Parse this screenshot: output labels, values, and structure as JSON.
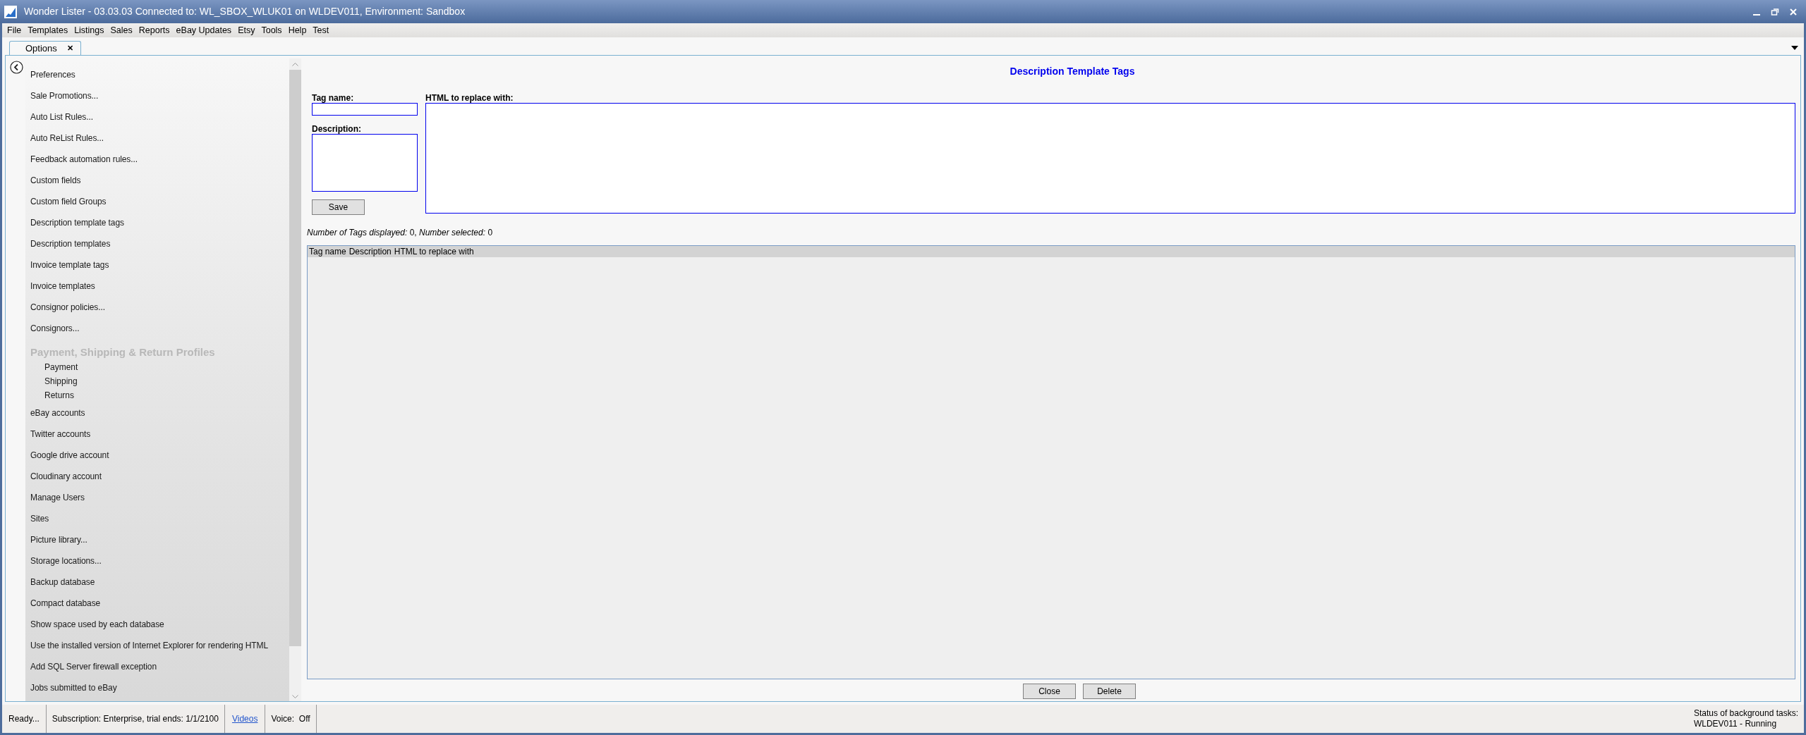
{
  "window": {
    "title": "Wonder Lister - 03.03.03 Connected to: WL_SBOX_WLUK01 on WLDEV011, Environment: Sandbox"
  },
  "menu": [
    "File",
    "Templates",
    "Listings",
    "Sales",
    "Reports",
    "eBay Updates",
    "Etsy",
    "Tools",
    "Help",
    "Test"
  ],
  "tabs": [
    {
      "label": "Options",
      "selected": true,
      "close": "✕"
    }
  ],
  "sidebar": {
    "items": [
      {
        "kind": "item",
        "label": "Preferences"
      },
      {
        "kind": "item",
        "label": "Sale Promotions..."
      },
      {
        "kind": "item",
        "label": "Auto List Rules..."
      },
      {
        "kind": "item",
        "label": "Auto ReList Rules..."
      },
      {
        "kind": "item",
        "label": "Feedback automation rules..."
      },
      {
        "kind": "item",
        "label": "Custom fields"
      },
      {
        "kind": "item",
        "label": "Custom field Groups"
      },
      {
        "kind": "item",
        "label": "Description template tags"
      },
      {
        "kind": "item",
        "label": "Description templates"
      },
      {
        "kind": "item",
        "label": "Invoice template tags"
      },
      {
        "kind": "item",
        "label": "Invoice templates"
      },
      {
        "kind": "item",
        "label": "Consignor policies..."
      },
      {
        "kind": "item",
        "label": "Consignors..."
      },
      {
        "kind": "heading",
        "label": "Payment, Shipping & Return Profiles"
      },
      {
        "kind": "sub",
        "label": "Payment"
      },
      {
        "kind": "sub",
        "label": "Shipping"
      },
      {
        "kind": "sub",
        "label": "Returns"
      },
      {
        "kind": "item",
        "label": "eBay accounts"
      },
      {
        "kind": "item",
        "label": "Twitter accounts"
      },
      {
        "kind": "item",
        "label": "Google drive account"
      },
      {
        "kind": "item",
        "label": "Cloudinary account"
      },
      {
        "kind": "item",
        "label": "Manage Users"
      },
      {
        "kind": "item",
        "label": "Sites"
      },
      {
        "kind": "item",
        "label": "Picture library..."
      },
      {
        "kind": "item",
        "label": "Storage locations..."
      },
      {
        "kind": "item",
        "label": "Backup database"
      },
      {
        "kind": "item",
        "label": "Compact database"
      },
      {
        "kind": "item",
        "label": "Show space used by each database"
      },
      {
        "kind": "item",
        "label": "Use the installed version of Internet Explorer for rendering HTML"
      },
      {
        "kind": "item",
        "label": "Add SQL Server firewall exception"
      },
      {
        "kind": "item",
        "label": "Jobs submitted to eBay"
      }
    ]
  },
  "panel": {
    "title": "Description Template Tags",
    "tag_name_label": "Tag name:",
    "description_label": "Description:",
    "html_label": "HTML to replace with:",
    "save": "Save",
    "summary": "*Number of Tags displayed:* 0, *Number selected:* 0",
    "table": {
      "columns": [
        "Tag name",
        "Description",
        "HTML to replace with"
      ]
    },
    "buttons": [
      "Close",
      "Delete"
    ]
  },
  "status_bar": {
    "ready": "Ready...",
    "subscription": "Subscription: Enterprise, trial ends: 1/1/2100",
    "videos": "Videos",
    "voice": "Voice:  Off",
    "tasks_title": "Status of background tasks:",
    "tasks_status": "WLDEV011 - Running"
  }
}
